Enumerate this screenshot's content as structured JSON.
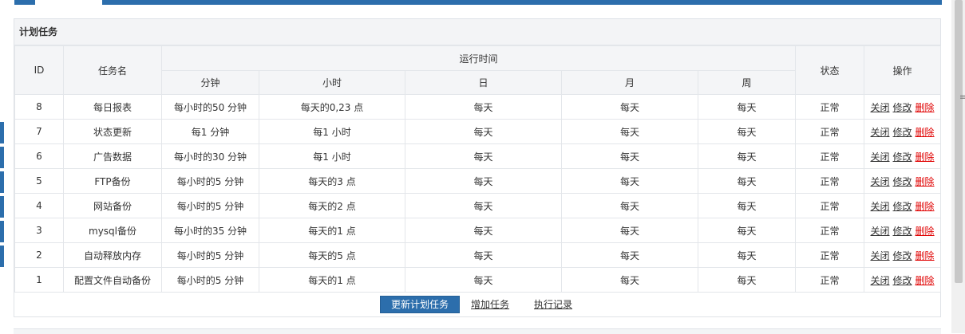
{
  "panel": {
    "title": "计划任务"
  },
  "table": {
    "headers": {
      "id": "ID",
      "name": "任务名",
      "run_time": "运行时间",
      "minute": "分钟",
      "hour": "小时",
      "day": "日",
      "month": "月",
      "week": "周",
      "status": "状态",
      "actions": "操作"
    },
    "rows": [
      {
        "id": "8",
        "name": "每日报表",
        "minute": "每小时的50 分钟",
        "hour": "每天的0,23 点",
        "day": "每天",
        "month": "每天",
        "week": "每天",
        "status": "正常"
      },
      {
        "id": "7",
        "name": "状态更新",
        "minute": "每1 分钟",
        "hour": "每1 小时",
        "day": "每天",
        "month": "每天",
        "week": "每天",
        "status": "正常"
      },
      {
        "id": "6",
        "name": "广告数据",
        "minute": "每小时的30 分钟",
        "hour": "每1 小时",
        "day": "每天",
        "month": "每天",
        "week": "每天",
        "status": "正常"
      },
      {
        "id": "5",
        "name": "FTP备份",
        "minute": "每小时的5 分钟",
        "hour": "每天的3 点",
        "day": "每天",
        "month": "每天",
        "week": "每天",
        "status": "正常"
      },
      {
        "id": "4",
        "name": "网站备份",
        "minute": "每小时的5 分钟",
        "hour": "每天的2 点",
        "day": "每天",
        "month": "每天",
        "week": "每天",
        "status": "正常"
      },
      {
        "id": "3",
        "name": "mysql备份",
        "minute": "每小时的35 分钟",
        "hour": "每天的1 点",
        "day": "每天",
        "month": "每天",
        "week": "每天",
        "status": "正常"
      },
      {
        "id": "2",
        "name": "自动释放内存",
        "minute": "每小时的5 分钟",
        "hour": "每天的5 点",
        "day": "每天",
        "month": "每天",
        "week": "每天",
        "status": "正常"
      },
      {
        "id": "1",
        "name": "配置文件自动备份",
        "minute": "每小时的5 分钟",
        "hour": "每天的1 点",
        "day": "每天",
        "month": "每天",
        "week": "每天",
        "status": "正常"
      }
    ],
    "actions": {
      "close": "关闭",
      "edit": "修改",
      "delete": "删除"
    }
  },
  "footer": {
    "update_button": "更新计划任务",
    "add_link": "增加任务",
    "log_link": "执行记录"
  },
  "colors": {
    "accent": "#2c6eac",
    "danger": "#e00000"
  },
  "icons": {
    "scrollbar_grip": "grip-lines-icon"
  }
}
